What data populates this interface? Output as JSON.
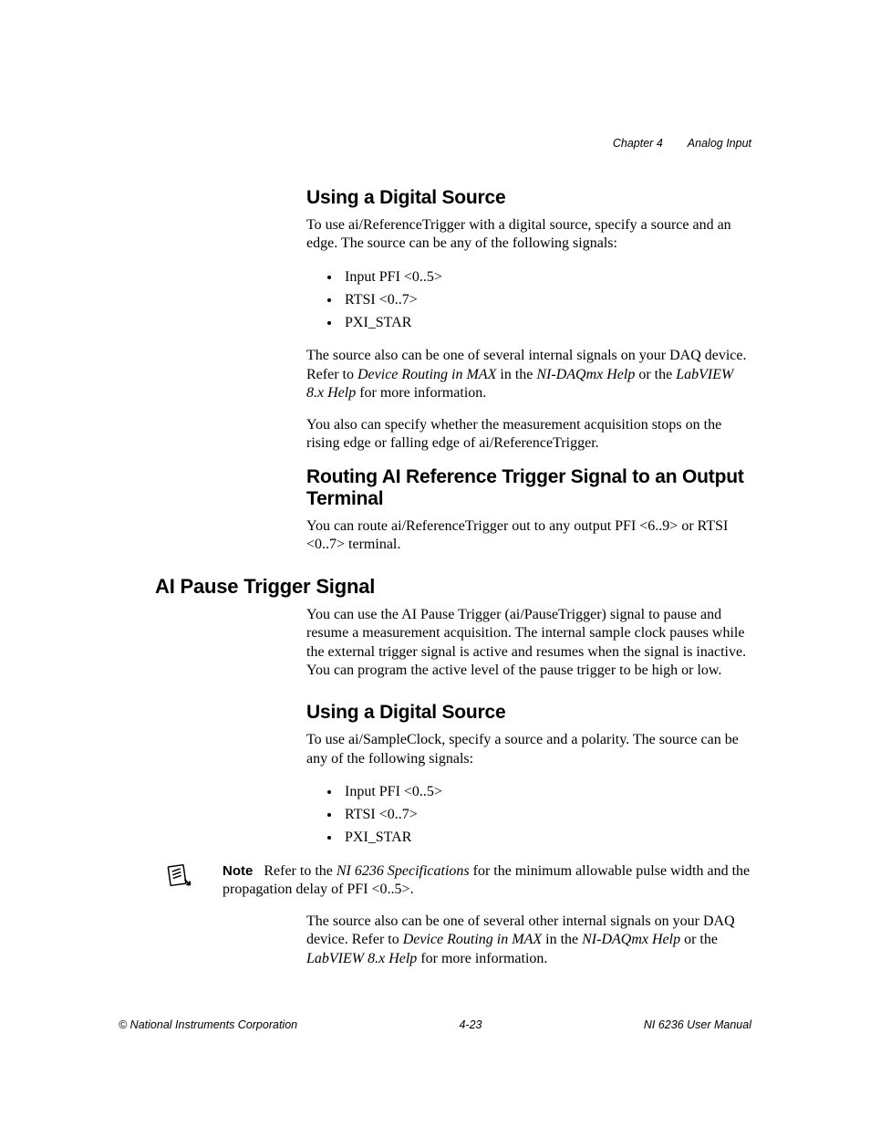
{
  "header": {
    "chapter": "Chapter 4",
    "title": "Analog Input"
  },
  "s1": {
    "heading": "Using a Digital Source",
    "p1a": "To use ai/ReferenceTrigger with a digital source, specify a source and an edge. The source can be any of the following signals:",
    "bullets": [
      "Input PFI <0..5>",
      "RTSI <0..7>",
      "PXI_STAR"
    ],
    "p2_a": "The source also can be one of several internal signals on your DAQ device. Refer to ",
    "p2_i1": "Device Routing in MAX",
    "p2_b": " in the ",
    "p2_i2": "NI-DAQmx Help",
    "p2_c": " or the ",
    "p2_i3": "LabVIEW 8.x Help",
    "p2_d": " for more information.",
    "p3": "You also can specify whether the measurement acquisition stops on the rising edge or falling edge of ai/ReferenceTrigger."
  },
  "s2": {
    "heading": "Routing AI Reference Trigger Signal to an Output Terminal",
    "p1": "You can route ai/ReferenceTrigger out to any output PFI <6..9> or RTSI <0..7> terminal."
  },
  "s3": {
    "heading": "AI Pause Trigger Signal",
    "p1": "You can use the AI Pause Trigger (ai/PauseTrigger) signal to pause and resume a measurement acquisition. The internal sample clock pauses while the external trigger signal is active and resumes when the signal is inactive. You can program the active level of the pause trigger to be high or low."
  },
  "s4": {
    "heading": "Using a Digital Source",
    "p1": "To use ai/SampleClock, specify a source and a polarity. The source can be any of the following signals:",
    "bullets": [
      "Input PFI <0..5>",
      "RTSI <0..7>",
      "PXI_STAR"
    ]
  },
  "note": {
    "label": "Note",
    "a": "Refer to the ",
    "i1": "NI 6236 Specifications",
    "b": " for the minimum allowable pulse width and the propagation delay of PFI <0..5>."
  },
  "s5": {
    "p1_a": "The source also can be one of several other internal signals on your DAQ device. Refer to ",
    "p1_i1": "Device Routing in MAX",
    "p1_b": " in the ",
    "p1_i2": "NI-DAQmx Help",
    "p1_c": " or the ",
    "p1_i3": "LabVIEW 8.x Help",
    "p1_d": " for more information."
  },
  "footer": {
    "left": "© National Instruments Corporation",
    "center": "4-23",
    "right": "NI 6236 User Manual"
  }
}
